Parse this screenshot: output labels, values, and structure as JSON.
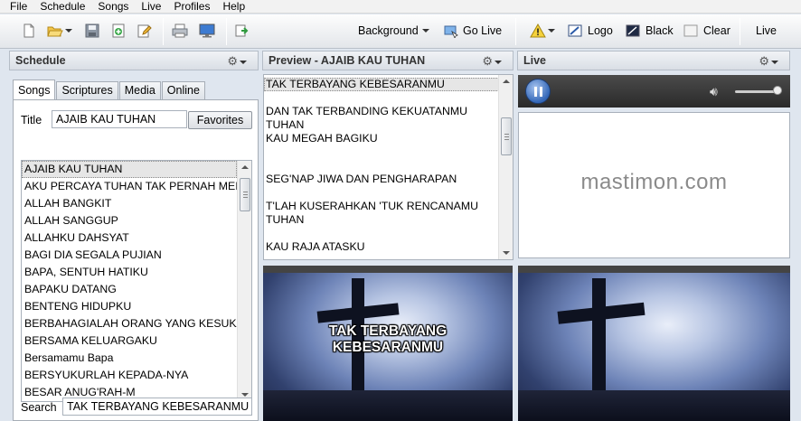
{
  "menu": [
    "File",
    "Schedule",
    "Songs",
    "Live",
    "Profiles",
    "Help"
  ],
  "toolbar": {
    "background_label": "Background",
    "golive_label": "Go Live",
    "logo_label": "Logo",
    "black_label": "Black",
    "clear_label": "Clear",
    "live_label": "Live"
  },
  "schedule": {
    "header": "Schedule",
    "tabs": [
      "Songs",
      "Scriptures",
      "Media",
      "Online"
    ],
    "title_label": "Title",
    "title_value": "AJAIB KAU TUHAN",
    "favorites_label": "Favorites",
    "songs": [
      "AJAIB KAU TUHAN",
      "AKU PERCAYA TUHAN TAK PERNAH MEI",
      "ALLAH BANGKIT",
      "ALLAH SANGGUP",
      "ALLAHKU DAHSYAT",
      "BAGI DIA SEGALA PUJIAN",
      "BAPA, SENTUH HATIKU",
      "BAPAKU DATANG",
      "BENTENG HIDUPKU",
      "BERBAHAGIALAH ORANG YANG KESUKA",
      "BERSAMA KELUARGAKU",
      "Bersamamu Bapa",
      "BERSYUKURLAH KEPADA-NYA",
      "BESAR ANUG'RAH-M"
    ],
    "search_label": "Search",
    "search_value": "TAK TERBAYANG KEBESARANMU"
  },
  "preview": {
    "header": "Preview - AJAIB KAU TUHAN",
    "verses": [
      "TAK TERBAYANG KEBESARANMU",
      "DAN TAK TERBANDING KEKUATANMU TUHAN",
      "KAU MEGAH BAGIKU",
      "SEG'NAP JIWA DAN PENGHARAPAN",
      "T'LAH KUSERAHKAN 'TUK RENCANAMU TUHAN",
      "KAU RAJA ATASKU"
    ],
    "slide_line1": "TAK TERBAYANG",
    "slide_line2": "KEBESARANMU"
  },
  "live": {
    "header": "Live",
    "watermark": "mastimon.com"
  },
  "colors": {
    "panel_header_bg": "#dde2e8",
    "selected_row": "#e6e6e6",
    "player_bg": "#333333",
    "play_button": "#3266b7"
  }
}
